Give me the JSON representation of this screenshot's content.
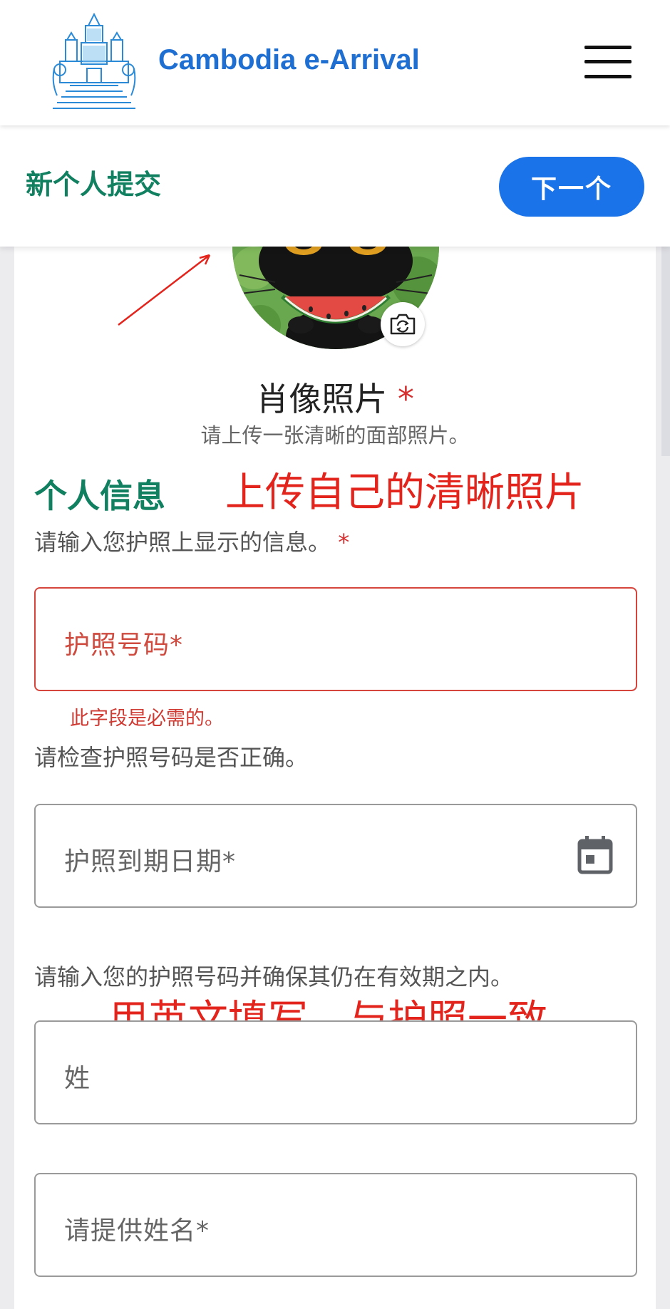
{
  "header": {
    "title": "Cambodia e-Arrival",
    "logo_icon": "angkor-temple-logo",
    "menu_icon": "hamburger-menu-icon"
  },
  "subheader": {
    "title": "新个人提交",
    "next_label": "下一个"
  },
  "photo": {
    "label": "肖像照片",
    "required_mark": "*",
    "hint": "请上传一张清晰的面部照片。",
    "camera_icon": "camera-rotate-icon"
  },
  "section": {
    "title": "个人信息",
    "hint": "请输入您护照上显示的信息。",
    "required_mark": "*"
  },
  "fields": {
    "passport_number": {
      "placeholder": "护照号码*",
      "error": "此字段是必需的。",
      "helper": "请检查护照号码是否正确。"
    },
    "passport_expiry": {
      "placeholder": "护照到期日期*",
      "icon": "calendar-icon",
      "helper": "请输入您的护照号码并确保其仍在有效期之内。"
    },
    "surname": {
      "placeholder": "姓"
    },
    "given_name": {
      "placeholder": "请提供姓名*"
    }
  },
  "annotations": {
    "photo_note": "上传自己的清晰照片",
    "name_note": "用英文填写，与护照一致"
  },
  "colors": {
    "brand_blue": "#1e6fd1",
    "button_blue": "#1a73e8",
    "section_green": "#118060",
    "error_red": "#cf3b33",
    "annotation_red": "#e3241c"
  }
}
